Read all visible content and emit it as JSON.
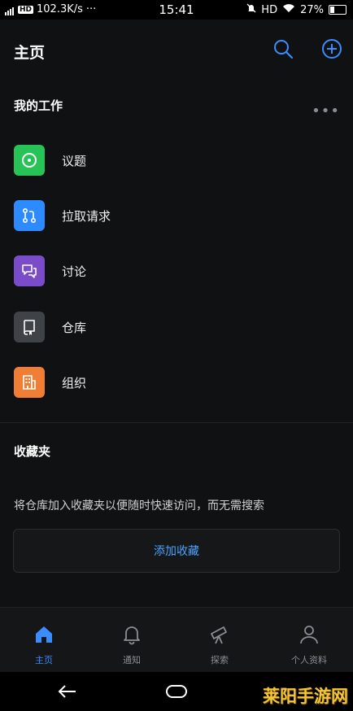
{
  "status": {
    "speed": "102.3K/s",
    "dots": "···",
    "time": "15:41",
    "network": "HD",
    "battery": "27%"
  },
  "header": {
    "title": "主页"
  },
  "my_work": {
    "title": "我的工作",
    "items": [
      {
        "label": "议题",
        "icon": "issue-icon",
        "color": "#27c357"
      },
      {
        "label": "拉取请求",
        "icon": "pull-request-icon",
        "color": "#2e8bff"
      },
      {
        "label": "讨论",
        "icon": "discussion-icon",
        "color": "#7b4cc9"
      },
      {
        "label": "仓库",
        "icon": "repo-icon",
        "color": "#3f4246"
      },
      {
        "label": "组织",
        "icon": "organization-icon",
        "color": "#f07f35"
      }
    ]
  },
  "favorites": {
    "title": "收藏夹",
    "hint": "将仓库加入收藏夹以便随时快速访问，而无需搜索",
    "add_label": "添加收藏"
  },
  "tabs": [
    {
      "label": "主页",
      "icon": "home-icon",
      "active": true
    },
    {
      "label": "通知",
      "icon": "bell-icon",
      "active": false
    },
    {
      "label": "探索",
      "icon": "telescope-icon",
      "active": false
    },
    {
      "label": "个人资料",
      "icon": "person-icon",
      "active": false
    }
  ],
  "watermark": "莱阳手游网",
  "colors": {
    "accent": "#3b8cff",
    "background": "#0f1112"
  }
}
